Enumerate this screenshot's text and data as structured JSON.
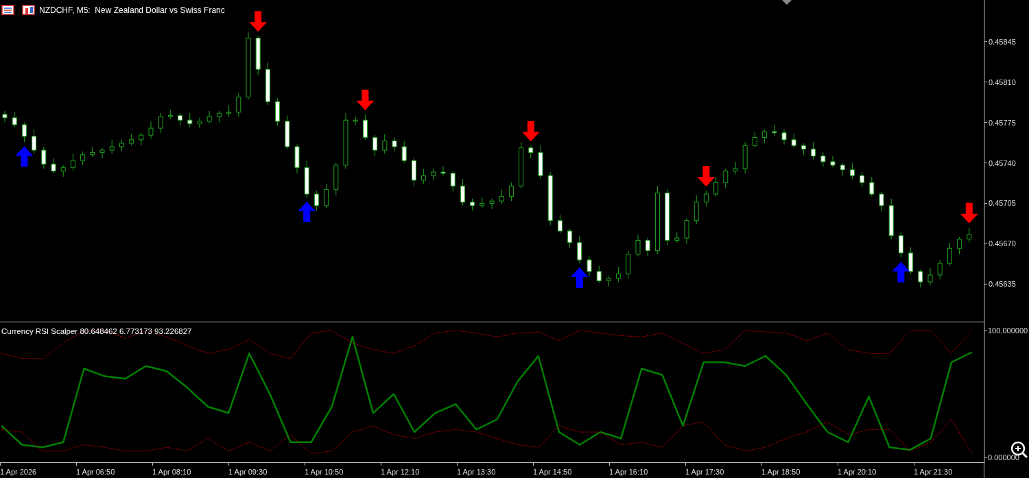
{
  "chart_window": {
    "symbol_title": "NZDCHF, M5:  New Zealand Dollar vs Swiss Franc",
    "time_axis": [
      "1 Apr 2026",
      "1 Apr 06:50",
      "1 Apr 08:10",
      "1 Apr 09:30",
      "1 Apr 10:50",
      "1 Apr 12:10",
      "1 Apr 13:30",
      "1 Apr 14:50",
      "1 Apr 16:10",
      "1 Apr 17:30",
      "1 Apr 18:50",
      "1 Apr 20:10",
      "1 Apr 21:30"
    ],
    "chart_data": {
      "type": "candlestick",
      "ylim": [
        0.45602,
        0.45881
      ],
      "yticks": [
        {
          "value": 0.45845,
          "label": "0.45845"
        },
        {
          "value": 0.4581,
          "label": "0.45810"
        },
        {
          "value": 0.45775,
          "label": "0.45775"
        },
        {
          "value": 0.4574,
          "label": "0.45740"
        },
        {
          "value": 0.45705,
          "label": "0.45705"
        },
        {
          "value": 0.4567,
          "label": "0.45670"
        },
        {
          "value": 0.45635,
          "label": "0.45635"
        }
      ],
      "ohlc": [
        [
          0.45782,
          0.45785,
          0.45775,
          0.45779
        ],
        [
          0.45779,
          0.45784,
          0.45771,
          0.45773
        ],
        [
          0.45773,
          0.45775,
          0.45758,
          0.45763
        ],
        [
          0.45763,
          0.45769,
          0.45748,
          0.45751
        ],
        [
          0.45751,
          0.45754,
          0.45735,
          0.45739
        ],
        [
          0.45739,
          0.45744,
          0.45731,
          0.45733
        ],
        [
          0.45733,
          0.45738,
          0.45728,
          0.45736
        ],
        [
          0.45736,
          0.45748,
          0.45733,
          0.45742
        ],
        [
          0.45742,
          0.4575,
          0.45738,
          0.45747
        ],
        [
          0.45747,
          0.45754,
          0.45745,
          0.45749
        ],
        [
          0.45749,
          0.45753,
          0.45744,
          0.45751
        ],
        [
          0.45751,
          0.4576,
          0.45748,
          0.45754
        ],
        [
          0.45754,
          0.4576,
          0.4575,
          0.45757
        ],
        [
          0.45757,
          0.45765,
          0.45755,
          0.4576
        ],
        [
          0.4576,
          0.45766,
          0.45755,
          0.45764
        ],
        [
          0.45764,
          0.45776,
          0.45761,
          0.4577
        ],
        [
          0.4577,
          0.45783,
          0.45766,
          0.4578
        ],
        [
          0.4578,
          0.45786,
          0.45778,
          0.45781
        ],
        [
          0.45781,
          0.45783,
          0.45772,
          0.45777
        ],
        [
          0.45777,
          0.45783,
          0.45771,
          0.45774
        ],
        [
          0.45774,
          0.45779,
          0.4577,
          0.45776
        ],
        [
          0.45776,
          0.45785,
          0.45774,
          0.4578
        ],
        [
          0.4578,
          0.45785,
          0.45775,
          0.45783
        ],
        [
          0.45783,
          0.4579,
          0.4578,
          0.45784
        ],
        [
          0.45784,
          0.458,
          0.4578,
          0.45797
        ],
        [
          0.45797,
          0.45853,
          0.45795,
          0.45848
        ],
        [
          0.45848,
          0.4585,
          0.45816,
          0.45821
        ],
        [
          0.45821,
          0.45827,
          0.4579,
          0.45793
        ],
        [
          0.45793,
          0.45796,
          0.45772,
          0.45776
        ],
        [
          0.45776,
          0.45781,
          0.45752,
          0.45754
        ],
        [
          0.45754,
          0.45756,
          0.45731,
          0.45736
        ],
        [
          0.45736,
          0.45742,
          0.4571,
          0.45713
        ],
        [
          0.45713,
          0.45716,
          0.45699,
          0.45703
        ],
        [
          0.45703,
          0.45722,
          0.45701,
          0.45717
        ],
        [
          0.45717,
          0.4574,
          0.45712,
          0.45738
        ],
        [
          0.45738,
          0.45783,
          0.45735,
          0.45777
        ],
        [
          0.45777,
          0.4578,
          0.45773,
          0.45777
        ],
        [
          0.45777,
          0.45782,
          0.4576,
          0.45762
        ],
        [
          0.45762,
          0.45764,
          0.45746,
          0.45751
        ],
        [
          0.45751,
          0.45765,
          0.45748,
          0.45759
        ],
        [
          0.45759,
          0.45762,
          0.4575,
          0.45754
        ],
        [
          0.45754,
          0.45759,
          0.4574,
          0.45742
        ],
        [
          0.45742,
          0.45744,
          0.4572,
          0.45725
        ],
        [
          0.45725,
          0.45735,
          0.45722,
          0.45729
        ],
        [
          0.45729,
          0.45735,
          0.45725,
          0.45732
        ],
        [
          0.45732,
          0.45737,
          0.45729,
          0.45731
        ],
        [
          0.45731,
          0.45733,
          0.45715,
          0.4572
        ],
        [
          0.4572,
          0.45726,
          0.45703,
          0.45706
        ],
        [
          0.45706,
          0.45709,
          0.45699,
          0.45703
        ],
        [
          0.45703,
          0.4571,
          0.45701,
          0.45705
        ],
        [
          0.45705,
          0.45709,
          0.457,
          0.45707
        ],
        [
          0.45707,
          0.45717,
          0.45704,
          0.45711
        ],
        [
          0.45711,
          0.45723,
          0.45707,
          0.4572
        ],
        [
          0.4572,
          0.45758,
          0.45718,
          0.45753
        ],
        [
          0.45753,
          0.45755,
          0.45744,
          0.45749
        ],
        [
          0.45749,
          0.45755,
          0.45726,
          0.45729
        ],
        [
          0.45729,
          0.45732,
          0.45686,
          0.4569
        ],
        [
          0.4569,
          0.45695,
          0.45679,
          0.45681
        ],
        [
          0.45681,
          0.45683,
          0.45666,
          0.45671
        ],
        [
          0.45671,
          0.45677,
          0.45653,
          0.45656
        ],
        [
          0.45656,
          0.45659,
          0.45642,
          0.45646
        ],
        [
          0.45646,
          0.45651,
          0.45636,
          0.45638
        ],
        [
          0.45638,
          0.45642,
          0.45633,
          0.4564
        ],
        [
          0.4564,
          0.4565,
          0.45637,
          0.45644
        ],
        [
          0.45644,
          0.45664,
          0.4564,
          0.45661
        ],
        [
          0.45661,
          0.45678,
          0.45659,
          0.45673
        ],
        [
          0.45673,
          0.45675,
          0.45659,
          0.45664
        ],
        [
          0.45664,
          0.4572,
          0.45661,
          0.45714
        ],
        [
          0.45714,
          0.45717,
          0.45669,
          0.45673
        ],
        [
          0.45673,
          0.4568,
          0.45671,
          0.45675
        ],
        [
          0.45675,
          0.45692,
          0.4567,
          0.4569
        ],
        [
          0.4569,
          0.45712,
          0.45687,
          0.45706
        ],
        [
          0.45706,
          0.45716,
          0.45702,
          0.45713
        ],
        [
          0.45713,
          0.45728,
          0.45711,
          0.45723
        ],
        [
          0.45723,
          0.45735,
          0.45718,
          0.45733
        ],
        [
          0.45733,
          0.45741,
          0.4573,
          0.45735
        ],
        [
          0.45735,
          0.45758,
          0.45731,
          0.45755
        ],
        [
          0.45755,
          0.45767,
          0.45753,
          0.45762
        ],
        [
          0.45762,
          0.45769,
          0.45757,
          0.45767
        ],
        [
          0.45767,
          0.45773,
          0.45763,
          0.45766
        ],
        [
          0.45766,
          0.45769,
          0.45756,
          0.4576
        ],
        [
          0.4576,
          0.45765,
          0.45753,
          0.45755
        ],
        [
          0.45755,
          0.45757,
          0.45747,
          0.45752
        ],
        [
          0.45752,
          0.45758,
          0.45743,
          0.45746
        ],
        [
          0.45746,
          0.45749,
          0.45737,
          0.45741
        ],
        [
          0.45741,
          0.45746,
          0.45736,
          0.45738
        ],
        [
          0.45738,
          0.4574,
          0.45729,
          0.45734
        ],
        [
          0.45734,
          0.4574,
          0.45726,
          0.45729
        ],
        [
          0.45729,
          0.45732,
          0.45719,
          0.45723
        ],
        [
          0.45723,
          0.45728,
          0.45711,
          0.45713
        ],
        [
          0.45713,
          0.45715,
          0.45698,
          0.45703
        ],
        [
          0.45703,
          0.45709,
          0.45674,
          0.45677
        ],
        [
          0.45677,
          0.4568,
          0.45658,
          0.45662
        ],
        [
          0.45662,
          0.45667,
          0.45644,
          0.45646
        ],
        [
          0.45646,
          0.45648,
          0.45632,
          0.45637
        ],
        [
          0.45637,
          0.45649,
          0.45634,
          0.45643
        ],
        [
          0.45643,
          0.45656,
          0.45639,
          0.45653
        ],
        [
          0.45653,
          0.45671,
          0.45651,
          0.45666
        ],
        [
          0.45666,
          0.45676,
          0.45661,
          0.45674
        ],
        [
          0.45674,
          0.45684,
          0.45671,
          0.45678
        ]
      ]
    }
  },
  "indicator": {
    "chart_data": {
      "type": "line",
      "title": "Currency RSI Scalper 80.648462 6.773173 93.226827",
      "ylim": [
        -4.3,
        106.5
      ],
      "yticks": [
        {
          "value": 100,
          "label": "100.000000"
        },
        {
          "value": 0,
          "label": "0.000000"
        }
      ],
      "series": [
        {
          "color": "#008000",
          "line_style": "solid",
          "values": [
            25,
            10,
            8,
            12,
            70,
            64,
            62,
            72,
            68,
            55,
            40,
            35,
            82,
            50,
            12,
            12,
            40,
            95,
            35,
            50,
            20,
            35,
            42,
            22,
            30,
            60,
            80,
            20,
            10,
            20,
            15,
            70,
            65,
            25,
            75,
            75,
            72,
            80,
            65,
            42,
            20,
            12,
            48,
            8,
            6,
            15,
            75,
            83
          ]
        },
        {
          "color": "#cc0000",
          "line_style": "dotted",
          "values": [
            82,
            78,
            78,
            90,
            100,
            100,
            94,
            100,
            95,
            88,
            82,
            85,
            93,
            82,
            78,
            98,
            100,
            90,
            85,
            82,
            88,
            98,
            100,
            98,
            95,
            98,
            99,
            92,
            100,
            98,
            96,
            95,
            98,
            90,
            82,
            85,
            100,
            99,
            98,
            92,
            98,
            85,
            82,
            82,
            100,
            100,
            82,
            100
          ]
        },
        {
          "color": "#cc0000",
          "line_style": "dotted",
          "values": [
            22,
            20,
            5,
            5,
            10,
            8,
            5,
            5,
            8,
            5,
            15,
            5,
            12,
            5,
            18,
            3,
            5,
            20,
            25,
            18,
            15,
            20,
            22,
            20,
            15,
            10,
            8,
            25,
            20,
            20,
            10,
            12,
            8,
            25,
            28,
            10,
            5,
            8,
            15,
            20,
            28,
            18,
            22,
            22,
            5,
            12,
            30,
            3
          ]
        }
      ]
    }
  }
}
